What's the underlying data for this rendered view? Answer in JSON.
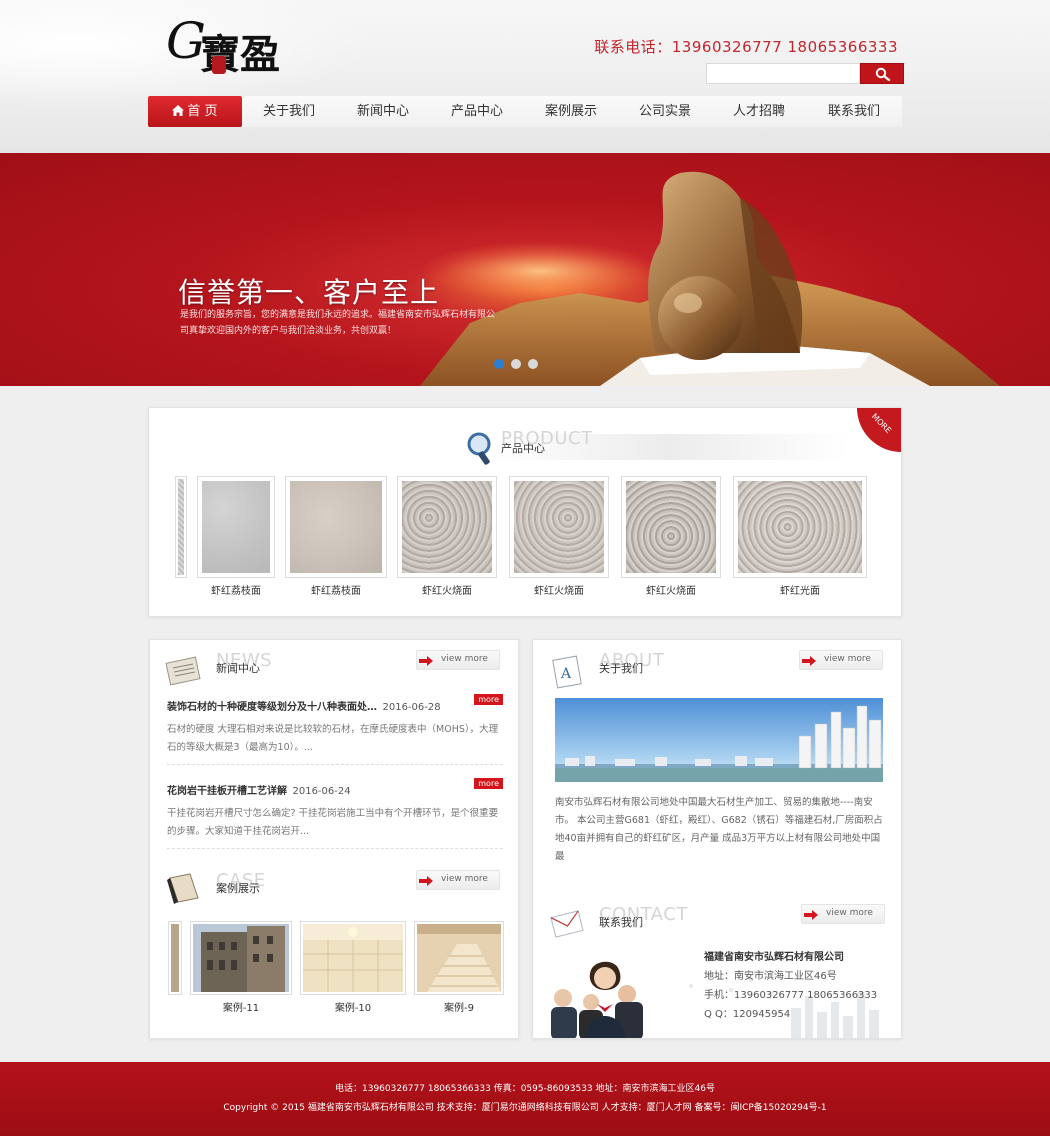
{
  "header": {
    "logo": {
      "letter": "G",
      "name": "寶盈"
    },
    "phone": "联系电话：13960326777 18065366333",
    "search": {
      "placeholder": ""
    }
  },
  "nav": {
    "items": [
      {
        "label": "首 页",
        "active": true
      },
      {
        "label": "关于我们"
      },
      {
        "label": "新闻中心"
      },
      {
        "label": "产品中心"
      },
      {
        "label": "案例展示"
      },
      {
        "label": "公司实景"
      },
      {
        "label": "人才招聘"
      },
      {
        "label": "联系我们"
      }
    ]
  },
  "banner": {
    "title": "信誉第一、客户至上",
    "subtitle": "是我们的服务宗旨，您的满意是我们永远的追求。福建省南安市弘辉石材有限公司真挚欢迎国内外的客户与我们洽淡业务，共创双赢！",
    "dots": 3
  },
  "product": {
    "title_en": "PRODUCT",
    "title_cn": "产品中心",
    "more": "MORE",
    "items": [
      {
        "label": ""
      },
      {
        "label": "虾红荔枝面"
      },
      {
        "label": "虾红荔枝面"
      },
      {
        "label": "虾红火烧面"
      },
      {
        "label": "虾红火烧面"
      },
      {
        "label": "虾红火烧面"
      },
      {
        "label": "虾红光面"
      }
    ]
  },
  "news": {
    "title_en": "NEWS",
    "title_cn": "新闻中心",
    "view_more": "view more",
    "items": [
      {
        "title": "装饰石材的十种硬度等级划分及十八种表面处…",
        "date": "2016-06-28",
        "more": "more",
        "summary": "石材的硬度 大理石相对来说是比较软的石材，在摩氏硬度表中（MOHS），大理石的等级大概是3（最高为10）。..."
      },
      {
        "title": "花岗岩干挂板开槽工艺详解",
        "date": "2016-06-24",
        "more": "more",
        "summary": "干挂花岗岩开槽尺寸怎么确定? 干挂花岗岩施工当中有个开槽环节，是个很重要的步骤。大家知道干挂花岗岩开..."
      }
    ]
  },
  "case": {
    "title_en": "CASE",
    "title_cn": "案例展示",
    "view_more": "view more",
    "items": [
      {
        "label": ""
      },
      {
        "label": "案例-11"
      },
      {
        "label": "案例-10"
      },
      {
        "label": "案例-9"
      }
    ]
  },
  "about": {
    "title_en": "ABOUT",
    "title_cn": "关于我们",
    "view_more": "view more",
    "text": "南安市弘辉石材有限公司地处中国最大石材生产加工、贸易的集散地----南安市。 本公司主营G681（虾红，殿红）、G682（锈石）等福建石材,厂房面积占地40亩并拥有自己的虾红矿区，月产量 成品3万平方以上材有限公司地处中国最"
  },
  "contact": {
    "title_en": "CONTACT",
    "title_cn": "联系我们",
    "view_more": "view more",
    "company": "福建省南安市弘辉石材有限公司",
    "address": "地址：南安市滨海工业区46号",
    "mobile": "手机：13960326777 18065366333",
    "qq": "Q Q：120945954"
  },
  "footer": {
    "line1": "电话：13960326777 18065366333 传真：0595-86093533 地址：南安市滨海工业区46号",
    "line2": "Copyright © 2015 福建省南安市弘辉石材有限公司 技术支持：厦门易尔通网络科技有限公司 人才支持：厦门人才网 备案号：闽ICP备15020294号-1"
  },
  "colors": {
    "brand_red": "#c0141b",
    "link_blue": "#2a7fd5"
  }
}
